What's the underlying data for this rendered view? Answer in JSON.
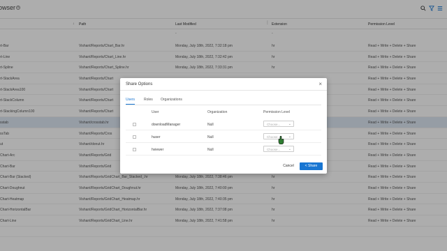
{
  "app": {
    "title": "owser"
  },
  "table": {
    "headers": {
      "path": "Path",
      "modified": "Last Modified",
      "extension": "Extension",
      "permission": "Permission Level"
    },
    "filter_row": {
      "modified": "-",
      "extension": "-"
    },
    "rows": [
      {
        "name": "rt-Bar",
        "path": "Vishant/Reports/Chart_Bar.hr",
        "modified": "Monday, July 18th, 2022, 7:32:18 pm",
        "ext": "hr",
        "perm": "Read + Write + Delete + Share"
      },
      {
        "name": "rt-Line",
        "path": "Vishant/Reports/Chart_Line.hr",
        "modified": "Monday, July 18th, 2022, 7:32:42 pm",
        "ext": "hr",
        "perm": "Read + Write + Delete + Share"
      },
      {
        "name": "rt-Spline",
        "path": "Vishant/Reports/Chart_Spline.hr",
        "modified": "Monday, July 18th, 2022, 7:33:31 pm",
        "ext": "hr",
        "perm": "Read + Write + Delete + Share"
      },
      {
        "name": "rt-StackArea",
        "path": "Vishant/Reports/Chart",
        "modified": "",
        "ext": "",
        "perm": "Read + Write + Delete + Share"
      },
      {
        "name": "rt-StackArea100",
        "path": "Vishant/Reports/Chart",
        "modified": "",
        "ext": "",
        "perm": "Read + Write + Delete + Share"
      },
      {
        "name": "rt-StackColumn",
        "path": "Vishant/Reports/Chart",
        "modified": "",
        "ext": "",
        "perm": "Read + Write + Delete + Share"
      },
      {
        "name": "rt-StackingColumn100",
        "path": "Vishant/Reports/Chart",
        "modified": "",
        "ext": "",
        "perm": "Read + Write + Delete + Share"
      },
      {
        "name": "sstab",
        "path": "Vishant/crosstab.hr",
        "modified": "",
        "ext": "",
        "perm": "Read + Write + Delete + Share",
        "selected": true
      },
      {
        "name": "ssTab",
        "path": "Vishant/Reports/Cros",
        "modified": "",
        "ext": "",
        "perm": "Read + Write + Delete + Share"
      },
      {
        "name": "ut",
        "path": "Vishant/donut.hr",
        "modified": "",
        "ext": "",
        "perm": "Read + Write + Delete + Share"
      },
      {
        "name": "Chart-Arc",
        "path": "Vishant/Reports/Grid",
        "modified": "",
        "ext": "",
        "perm": "Read + Write + Delete + Share"
      },
      {
        "name": "Chart-Bar",
        "path": "Vishant/Reports/Grid",
        "modified": "",
        "ext": "",
        "perm": "Read + Write + Delete + Share"
      },
      {
        "name": "Chart-Bar (Stacked)",
        "path": "Vishant/Reports/GridChart_Bar_Stacked_.hr",
        "modified": "Monday, July 18th, 2022, 7:38:46 pm",
        "ext": "hr",
        "perm": "Read + Write + Delete + Share"
      },
      {
        "name": "Chart-Doughnut",
        "path": "Vishant/Reports/GridChart_Doughnut.hr",
        "modified": "Monday, July 18th, 2022, 7:40:00 pm",
        "ext": "hr",
        "perm": "Read + Write + Delete + Share"
      },
      {
        "name": "Chart-Heatmap",
        "path": "Vishant/Reports/GridChart_Heatmap.hr",
        "modified": "Monday, July 18th, 2022, 7:40:35 pm",
        "ext": "hr",
        "perm": "Read + Write + Delete + Share"
      },
      {
        "name": "Chart-HorizontalBar",
        "path": "Vishant/Reports/GridChart_HorizontalBar.hr",
        "modified": "Monday, July 18th, 2022, 7:37:08 pm",
        "ext": "hr",
        "perm": "Read + Write + Delete + Share"
      },
      {
        "name": "Chart-Line",
        "path": "Vishant/Reports/GridChart_Line.hr",
        "modified": "Monday, July 18th, 2022, 7:41:58 pm",
        "ext": "hr",
        "perm": "Read + Write + Delete + Share"
      },
      {
        "name": "",
        "path": "",
        "modified": "",
        "ext": "",
        "perm": ""
      }
    ]
  },
  "dialog": {
    "title": "Share Options",
    "close": "×",
    "tabs": [
      "Users",
      "Roles",
      "Organizations"
    ],
    "columns": {
      "user": "User",
      "organization": "Organization",
      "permission": "Permission Level"
    },
    "users": [
      {
        "name": "downloadManager",
        "org": "Null",
        "choose": "Choose..."
      },
      {
        "name": "huser",
        "org": "Null",
        "choose": "Choose..."
      },
      {
        "name": "hviewer",
        "org": "Null",
        "choose": "Choose..."
      }
    ],
    "cancel_label": "Cancel",
    "share_label": "Share"
  },
  "colors": {
    "accent": "#1976d2",
    "selected_row": "#dde7f3"
  },
  "icons": [
    "search-icon",
    "filter-icon",
    "menu-icon",
    "settings-icon",
    "close-icon",
    "share-icon",
    "chevron-down-icon",
    "sort-icon",
    "kebab-icon",
    "cursor-icon"
  ]
}
